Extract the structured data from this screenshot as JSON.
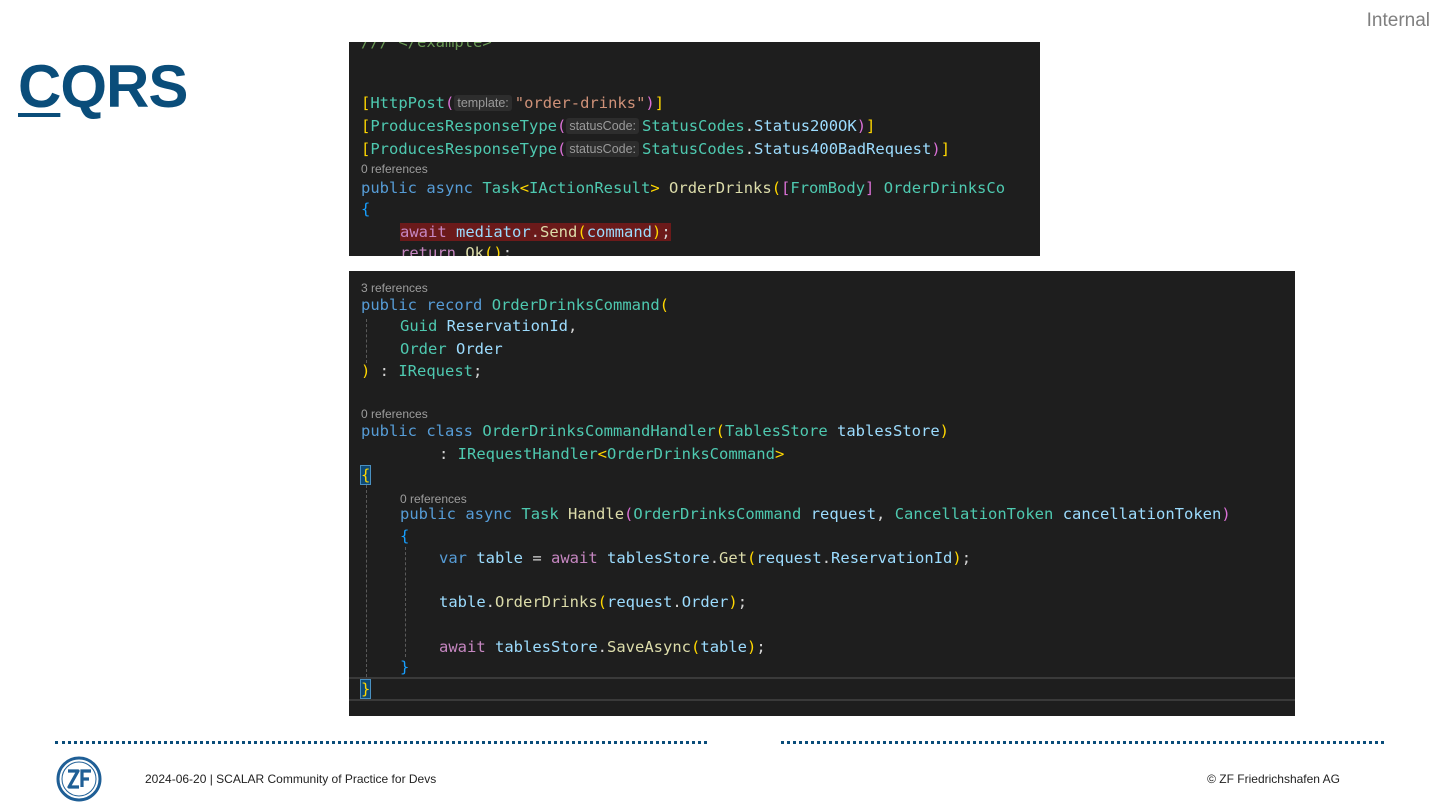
{
  "header": {
    "classification": "Internal",
    "title_first_letter": "C",
    "title_rest": "QRS"
  },
  "code_top": {
    "line0": "/// </example>",
    "http_post_attr": "HttpPost",
    "template_hint": "template:",
    "template_value": "\"order-drinks\"",
    "produces_attr": "ProducesResponseType",
    "status_hint": "statusCode:",
    "status_codes": "StatusCodes",
    "status_200": "Status200OK",
    "status_400": "Status400BadRequest",
    "refs": "0 references",
    "public": "public",
    "async": "async",
    "task": "Task",
    "iactionresult": "IActionResult",
    "method": "OrderDrinks",
    "frombody": "FromBody",
    "param_type": "OrderDrinksCo",
    "await": "await",
    "mediator": "mediator",
    "send": "Send",
    "command": "command",
    "return": "return",
    "ok": "Ok"
  },
  "code_bottom": {
    "refs3": "3 references",
    "refs0a": "0 references",
    "refs0b": "0 references",
    "public": "public",
    "record": "record",
    "cmd_name": "OrderDrinksCommand",
    "guid": "Guid",
    "reservation_id": "ReservationId",
    "order_type": "Order",
    "order_name": "Order",
    "irequest": "IRequest",
    "class": "class",
    "handler_name": "OrderDrinksCommandHandler",
    "tables_store_type": "TablesStore",
    "tables_store_param": "tablesStore",
    "irequest_handler": "IRequestHandler",
    "async": "async",
    "task": "Task",
    "handle": "Handle",
    "request": "request",
    "cancel_type": "CancellationToken",
    "cancel_param": "cancellationToken",
    "var": "var",
    "table": "table",
    "await": "await",
    "get": "Get",
    "order_drinks_method": "OrderDrinks",
    "save_async": "SaveAsync"
  },
  "footer": {
    "left": "2024-06-20 | SCALAR Community of Practice for Devs",
    "right": "© ZF Friedrichshafen AG",
    "logo_text": "ZF"
  },
  "colors": {
    "brand_blue": "#0a4d7a",
    "editor_bg": "#1e1e1e"
  }
}
